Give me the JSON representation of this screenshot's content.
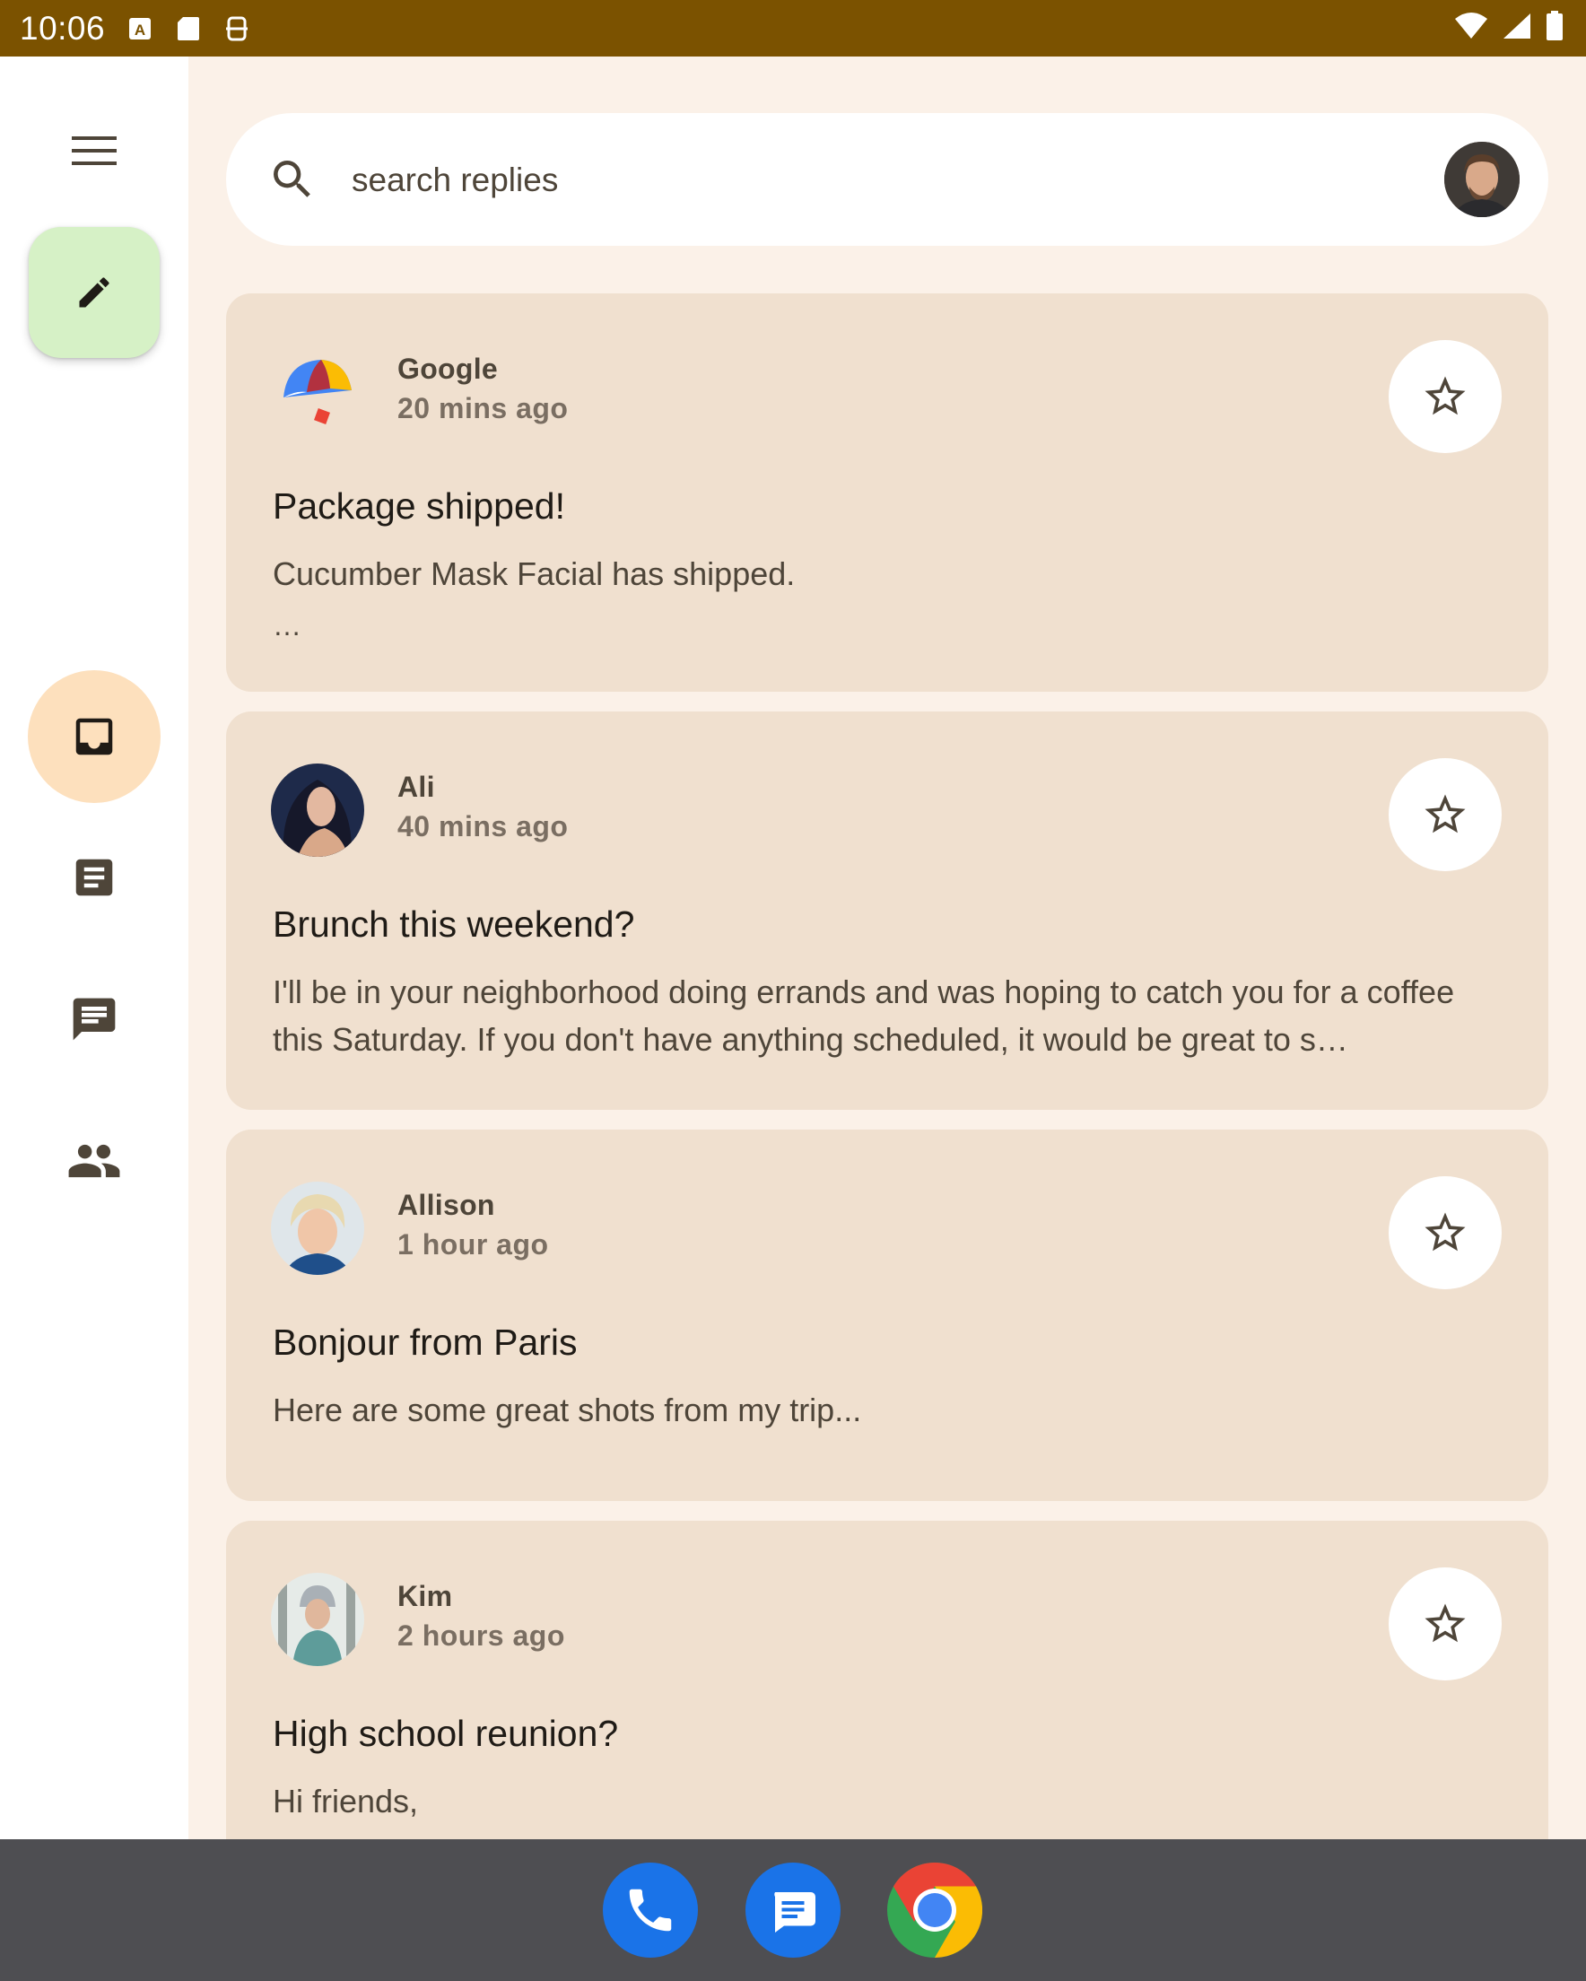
{
  "status_bar": {
    "time": "10:06",
    "left_icons": [
      "keyboard-a-icon",
      "sd-card-icon",
      "pip-icon"
    ],
    "right_icons": [
      "wifi-icon",
      "signal-icon",
      "battery-icon"
    ]
  },
  "nav_rail": {
    "menu_icon": "menu-icon",
    "compose_icon": "edit-pencil-icon",
    "items": [
      {
        "name": "inbox",
        "icon": "inbox-icon",
        "selected": true
      },
      {
        "name": "articles",
        "icon": "article-icon",
        "selected": false
      },
      {
        "name": "direct-messages",
        "icon": "chat-icon",
        "selected": false
      },
      {
        "name": "groups",
        "icon": "people-icon",
        "selected": false
      }
    ]
  },
  "search": {
    "placeholder": "search replies",
    "value": ""
  },
  "emails": [
    {
      "sender": "Google",
      "time": "20 mins ago",
      "subject": "Package shipped!",
      "body": "Cucumber Mask Facial has shipped.",
      "ellipsis": "…",
      "starred": false
    },
    {
      "sender": "Ali",
      "time": "40 mins ago",
      "subject": "Brunch this weekend?",
      "body": "I'll be in your neighborhood doing errands and was hoping to catch you for a coffee this Saturday. If you don't have anything scheduled, it would be great to s…",
      "ellipsis": "",
      "starred": false
    },
    {
      "sender": "Allison",
      "time": "1 hour ago",
      "subject": "Bonjour from Paris",
      "body": "Here are some great shots from my trip...",
      "ellipsis": "",
      "starred": false
    },
    {
      "sender": "Kim",
      "time": "2 hours ago",
      "subject": "High school reunion?",
      "body": "Hi friends,",
      "ellipsis": "…",
      "starred": false
    }
  ],
  "colors": {
    "status_bar": "#7b5200",
    "background": "#fbf1e8",
    "card": "#f0e0cf",
    "fab": "#d6f1c6",
    "nav_selected": "#fde0bd",
    "system_nav": "#4e4e52"
  },
  "dock": [
    {
      "app": "Phone",
      "icon": "phone-icon"
    },
    {
      "app": "Messages",
      "icon": "messages-icon"
    },
    {
      "app": "Chrome",
      "icon": "chrome-icon"
    }
  ]
}
